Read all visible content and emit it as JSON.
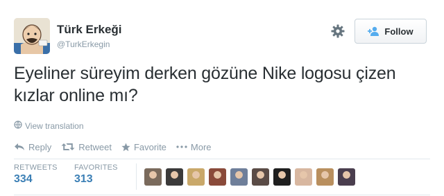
{
  "account": {
    "display_name": "Türk Erkeği",
    "username": "@TurkErkegin"
  },
  "header": {
    "follow_label": "Follow"
  },
  "tweet": {
    "text": "Eyeliner süreyim derken gözüne Nike logosu çizen kızlar online mı?",
    "view_translation": "View translation"
  },
  "actions": {
    "reply": "Reply",
    "retweet": "Retweet",
    "favorite": "Favorite",
    "more": "More"
  },
  "stats": {
    "retweets_label": "RETWEETS",
    "retweets_value": "334",
    "favorites_label": "FAVORITES",
    "favorites_value": "313"
  },
  "favoriters": [
    {
      "color": "#7a6a5c"
    },
    {
      "color": "#3b3a3a"
    },
    {
      "color": "#c9a86a"
    },
    {
      "color": "#8a4a3a"
    },
    {
      "color": "#6f7f9a"
    },
    {
      "color": "#5a4b46"
    },
    {
      "color": "#1f1f1f"
    },
    {
      "color": "#d8b7a0"
    },
    {
      "color": "#b98f5e"
    },
    {
      "color": "#4a3e4e"
    }
  ],
  "colors": {
    "link": "#3b7fb5",
    "muted": "#8899a6",
    "text": "#292f33"
  }
}
